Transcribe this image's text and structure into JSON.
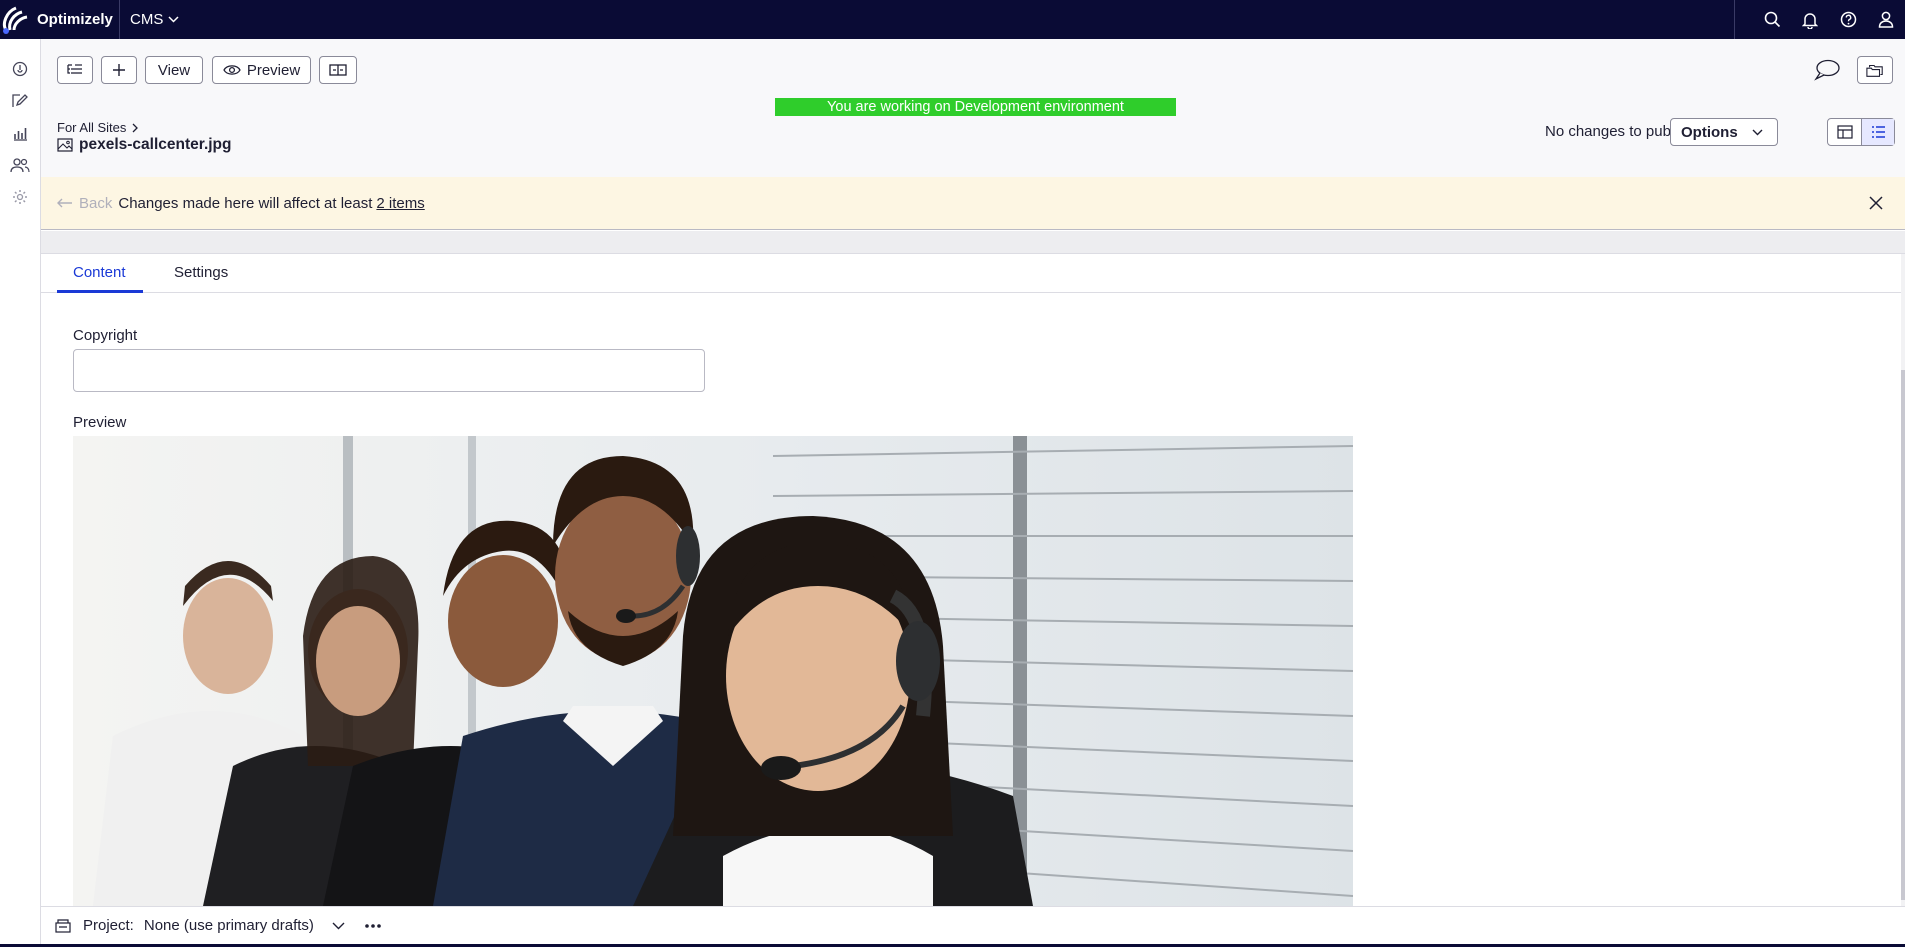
{
  "topbar": {
    "brand": "Optimizely",
    "product": "CMS",
    "icons": [
      "search-icon",
      "bell-icon",
      "help-icon",
      "user-icon"
    ]
  },
  "rail": {
    "icons": [
      "dashboard-icon",
      "edit-icon",
      "reports-icon",
      "users-icon",
      "settings-icon"
    ]
  },
  "toolbar": {
    "tree_icon": "page-tree-icon",
    "add_icon": "plus-icon",
    "view_label": "View",
    "preview_label": "Preview",
    "compare_icon": "compare-icon"
  },
  "env_banner": "You are working on Development environment",
  "breadcrumb": {
    "parent": "For All Sites",
    "filename": "pexels-callcenter.jpg"
  },
  "publish": {
    "status": "No changes to publish",
    "options_label": "Options"
  },
  "notice": {
    "back_label": "Back",
    "message": "Changes made here will affect at least",
    "link": "2 items"
  },
  "tabs": [
    {
      "label": "Content",
      "active": true
    },
    {
      "label": "Settings",
      "active": false
    }
  ],
  "fields": {
    "copyright_label": "Copyright",
    "copyright_value": "",
    "preview_label": "Preview"
  },
  "bottombar": {
    "project_label": "Project:",
    "project_value": "None (use primary drafts)"
  },
  "colors": {
    "topbar": "#0a0b35",
    "accent": "#1a39d6",
    "env_banner": "#2fcd2b",
    "notice_bg": "#fdf6e3"
  }
}
